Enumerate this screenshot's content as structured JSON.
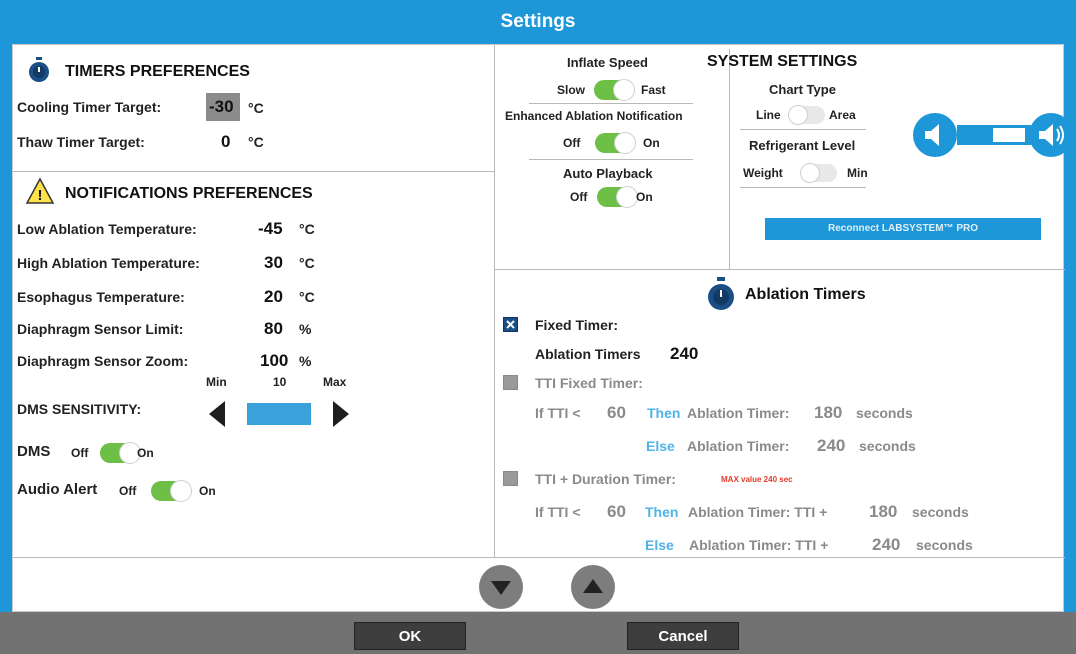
{
  "window": {
    "title": "Settings"
  },
  "timers": {
    "title": "TIMERS PREFERENCES",
    "cooling_label": "Cooling Timer Target:",
    "cooling_value": "-30",
    "cooling_unit": "°C",
    "thaw_label": "Thaw Timer Target:",
    "thaw_value": "0",
    "thaw_unit": "°C"
  },
  "notifications": {
    "title": "NOTIFICATIONS PREFERENCES",
    "rows": [
      {
        "label": "Low Ablation Temperature:",
        "value": "-45",
        "unit": "°C"
      },
      {
        "label": "High Ablation Temperature:",
        "value": "30",
        "unit": "°C"
      },
      {
        "label": "Esophagus Temperature:",
        "value": "20",
        "unit": "°C"
      },
      {
        "label": "Diaphragm Sensor Limit:",
        "value": "80",
        "unit": "%"
      },
      {
        "label": "Diaphragm Sensor Zoom:",
        "value": "100",
        "unit": "%"
      }
    ],
    "dms_min": "Min",
    "dms_value": "10",
    "dms_max": "Max",
    "dms_label": "DMS SENSITIVITY:",
    "dms_toggle_label": "DMS",
    "dms_off": "Off",
    "dms_on": "On",
    "audio_label": "Audio Alert",
    "audio_off": "Off",
    "audio_on": "On"
  },
  "system": {
    "title": "SYSTEM SETTINGS",
    "inflate_speed_label": "Inflate Speed",
    "inflate_slow": "Slow",
    "inflate_fast": "Fast",
    "enhanced_label": "Enhanced Ablation Notification",
    "enhanced_off": "Off",
    "enhanced_on": "On",
    "auto_playback_label": "Auto Playback",
    "auto_off": "Off",
    "auto_on": "On",
    "chart_type_label": "Chart Type",
    "chart_line": "Line",
    "chart_area": "Area",
    "refrigerant_label": "Refrigerant Level",
    "refrigerant_weight": "Weight",
    "refrigerant_min": "Min",
    "reconnect_label": "Reconnect LABSYSTEM™ PRO"
  },
  "ablation": {
    "title": "Ablation Timers",
    "fixed_timer_label": "Fixed Timer:",
    "fixed_ablation_label": "Ablation Timers",
    "fixed_ablation_value": "240",
    "tti_fixed_label": "TTI Fixed Timer:",
    "tti_if": "If TTI <",
    "tti_value": "60",
    "then": "Then",
    "else": "Else",
    "ablation_timer": "Ablation Timer:",
    "tti_then_value": "180",
    "tti_else_value": "240",
    "seconds": "seconds",
    "tti_duration_label": "TTI + Duration Timer:",
    "max_value_note": "MAX value 240 sec",
    "duration_if": "If TTI <",
    "duration_value": "60",
    "ablation_timer_tti": "Ablation Timer: TTI +",
    "duration_then_value": "180",
    "duration_else_value": "240"
  },
  "footer": {
    "ok": "OK",
    "cancel": "Cancel"
  },
  "colors": {
    "title_bar": "#1e97d9",
    "toggle_on": "#6dbf46",
    "footer": "#727272"
  }
}
